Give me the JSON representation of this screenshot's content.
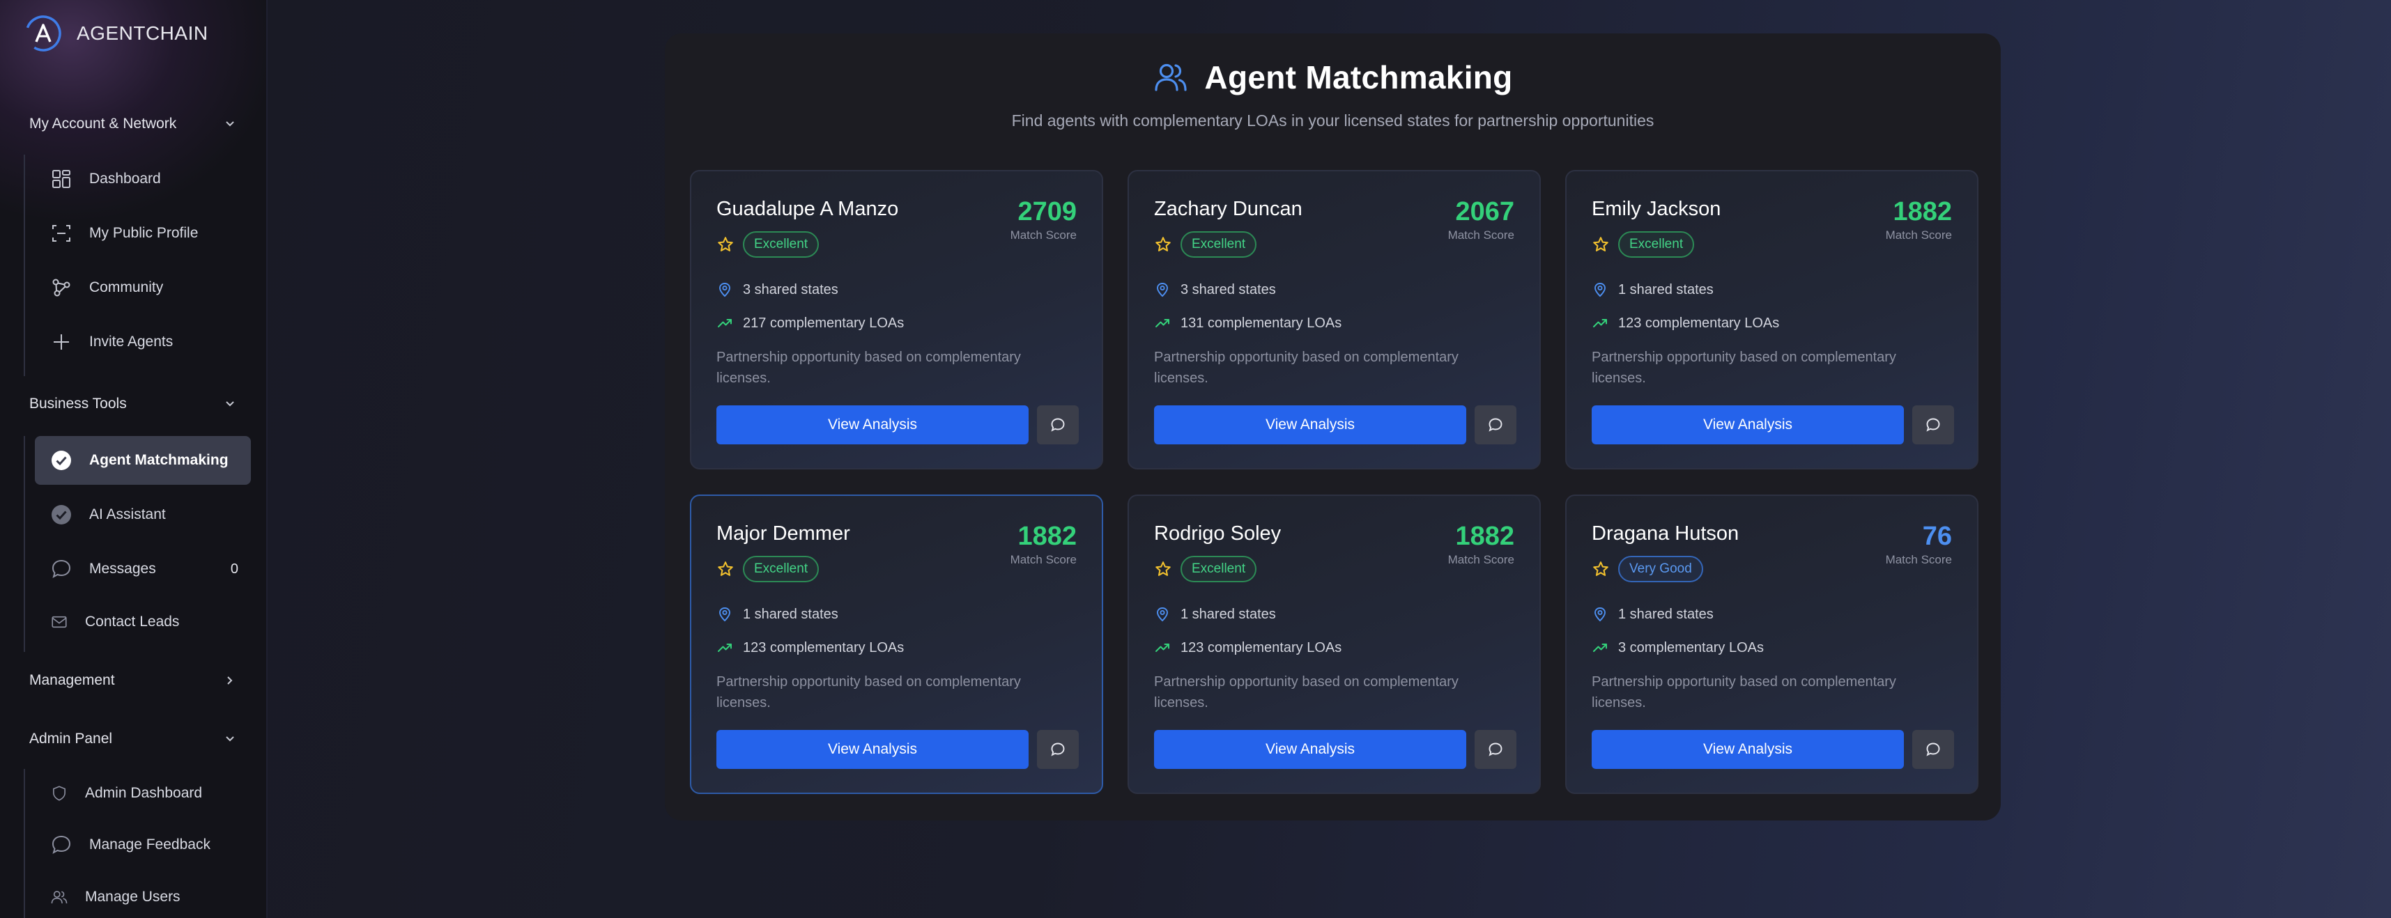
{
  "brand": {
    "name": "AGENTCHAIN"
  },
  "sidebar": {
    "sections": [
      {
        "label": "My Account & Network",
        "expanded": true
      },
      {
        "label": "Business Tools",
        "expanded": true
      },
      {
        "label": "Management",
        "expanded": false
      },
      {
        "label": "Admin Panel",
        "expanded": true
      }
    ],
    "account_items": [
      {
        "label": "Dashboard",
        "icon": "dashboard-grid-icon"
      },
      {
        "label": "My Public Profile",
        "icon": "scan-profile-icon"
      },
      {
        "label": "Community",
        "icon": "community-network-icon"
      },
      {
        "label": "Invite Agents",
        "icon": "plus-icon"
      }
    ],
    "business_items": [
      {
        "label": "Agent Matchmaking",
        "icon": "check-circle-icon",
        "active": true
      },
      {
        "label": "AI Assistant",
        "icon": "check-circle-icon"
      },
      {
        "label": "Messages",
        "icon": "chat-bubble-icon",
        "count": "0"
      },
      {
        "label": "Contact Leads",
        "icon": "mail-icon"
      }
    ],
    "admin_items": [
      {
        "label": "Admin Dashboard",
        "icon": "shield-icon"
      },
      {
        "label": "Manage Feedback",
        "icon": "chat-bubble-icon"
      },
      {
        "label": "Manage Users",
        "icon": "users-icon"
      }
    ]
  },
  "page": {
    "title": "Agent Matchmaking",
    "subtitle": "Find agents with complementary LOAs in your licensed states for partnership opportunities",
    "score_label": "Match Score",
    "view_label": "View Analysis"
  },
  "matches": [
    {
      "name": "Guadalupe A Manzo",
      "score": "2709",
      "rating": "Excellent",
      "shared_states": "3 shared states",
      "loas": "217 complementary LOAs",
      "description": "Partnership opportunity based on complementary licenses."
    },
    {
      "name": "Zachary Duncan",
      "score": "2067",
      "rating": "Excellent",
      "shared_states": "3 shared states",
      "loas": "131 complementary LOAs",
      "description": "Partnership opportunity based on complementary licenses."
    },
    {
      "name": "Emily Jackson",
      "score": "1882",
      "rating": "Excellent",
      "shared_states": "1 shared states",
      "loas": "123 complementary LOAs",
      "description": "Partnership opportunity based on complementary licenses."
    },
    {
      "name": "Major Demmer",
      "score": "1882",
      "rating": "Excellent",
      "shared_states": "1 shared states",
      "loas": "123 complementary LOAs",
      "description": "Partnership opportunity based on complementary licenses."
    },
    {
      "name": "Rodrigo Soley",
      "score": "1882",
      "rating": "Excellent",
      "shared_states": "1 shared states",
      "loas": "123 complementary LOAs",
      "description": "Partnership opportunity based on complementary licenses."
    },
    {
      "name": "Dragana Hutson",
      "score": "76",
      "rating": "Very Good",
      "shared_states": "1 shared states",
      "loas": "3 complementary LOAs",
      "description": "Partnership opportunity based on complementary licenses."
    }
  ],
  "colors": {
    "accent": "#2563eb",
    "score_excellent": "#34d17a",
    "score_very_good": "#4d8ff0",
    "panel": "#1c1c22",
    "sidebar": "#131319"
  }
}
